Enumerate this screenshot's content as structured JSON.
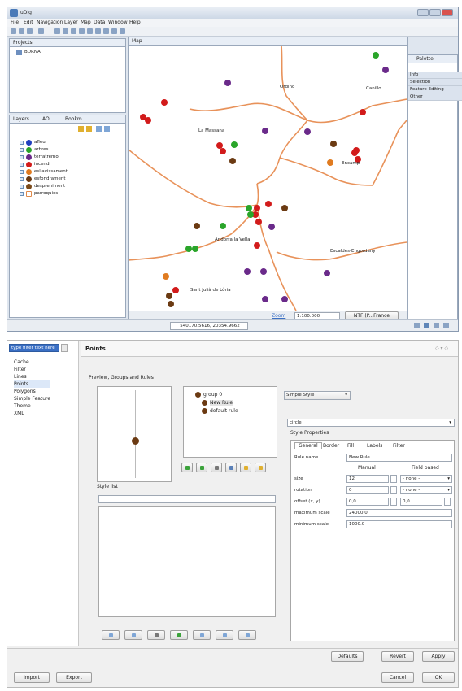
{
  "udig": {
    "title": "uDig",
    "menu": [
      "File",
      "Edit",
      "Navigation",
      "Layer",
      "Map",
      "Data",
      "Window",
      "Help"
    ],
    "projects_tab": "Projects",
    "project_item": "BDRNA",
    "layers_tabs": [
      "Layers",
      "AOI",
      "Bookm..."
    ],
    "layers": [
      {
        "name": "afleu",
        "color": "#1f3fbf"
      },
      {
        "name": "arbres",
        "color": "#2aa52a"
      },
      {
        "name": "terratremol",
        "color": "#6a2a8a"
      },
      {
        "name": "incendi",
        "color": "#d21b1b"
      },
      {
        "name": "esllavissament",
        "color": "#e07b20"
      },
      {
        "name": "esfondrament",
        "color": "#6b3a12"
      },
      {
        "name": "despreniment",
        "color": "#7a4a1a"
      },
      {
        "name": "parroquies",
        "color": "#e08a4a"
      }
    ],
    "map_tab": "Map",
    "map_labels": {
      "ordino": "Ordino",
      "canillo": "Canillo",
      "massana": "La Massana",
      "encamp": "Encamp",
      "andorra": "Andorra la Vella",
      "escaldes": "Escaldes-Engordany",
      "santjulia": "Sant Julià de Lòria"
    },
    "palette": {
      "title": "Palette",
      "items": [
        "Info",
        "Selection",
        "Feature Editing",
        "Other"
      ]
    },
    "status": {
      "zoom_label": "Zoom",
      "scale": "1:100.000",
      "crs": "NTF (P...France",
      "coords": "540170.5616, 20354.9662"
    }
  },
  "prefs": {
    "filter_placeholder": "type filter text here",
    "tree": [
      "Cache",
      "Filter",
      "Lines",
      "Points",
      "Polygons",
      "Simple Feature",
      "Theme",
      "XML"
    ],
    "page_title": "Points",
    "preview_label": "Preview, Groups and Rules",
    "groups": {
      "group": "group 0",
      "rule1": "New Rule",
      "rule2": "default rule"
    },
    "style_list_label": "Style list",
    "style_type": "Simple Style",
    "shape": "circle",
    "style_props_label": "Style Properties",
    "tabs": [
      "General",
      "Border",
      "Fill",
      "Labels",
      "Filter"
    ],
    "rule_name_label": "Rule name",
    "rule_name_value": "New Rule",
    "col_manual": "Manual",
    "col_field": "Field based",
    "size_label": "size",
    "size_value": "12",
    "none1": "- none -",
    "rotation_label": "rotation",
    "rotation_value": "0",
    "none2": "- none -",
    "offset_label": "offset (x, y)",
    "offset_x": "0,0",
    "offset_y": "0,0",
    "max_scale_label": "maximum scale",
    "max_scale_value": "24000.0",
    "min_scale_label": "minimum scale",
    "min_scale_value": "1000.0",
    "buttons": {
      "defaults": "Defaults",
      "revert": "Revert",
      "apply": "Apply",
      "import": "Import",
      "export": "Export",
      "cancel": "Cancel",
      "ok": "OK"
    }
  },
  "colors": {
    "border_line": "#e8925a",
    "accent": "#3a6fc4"
  }
}
